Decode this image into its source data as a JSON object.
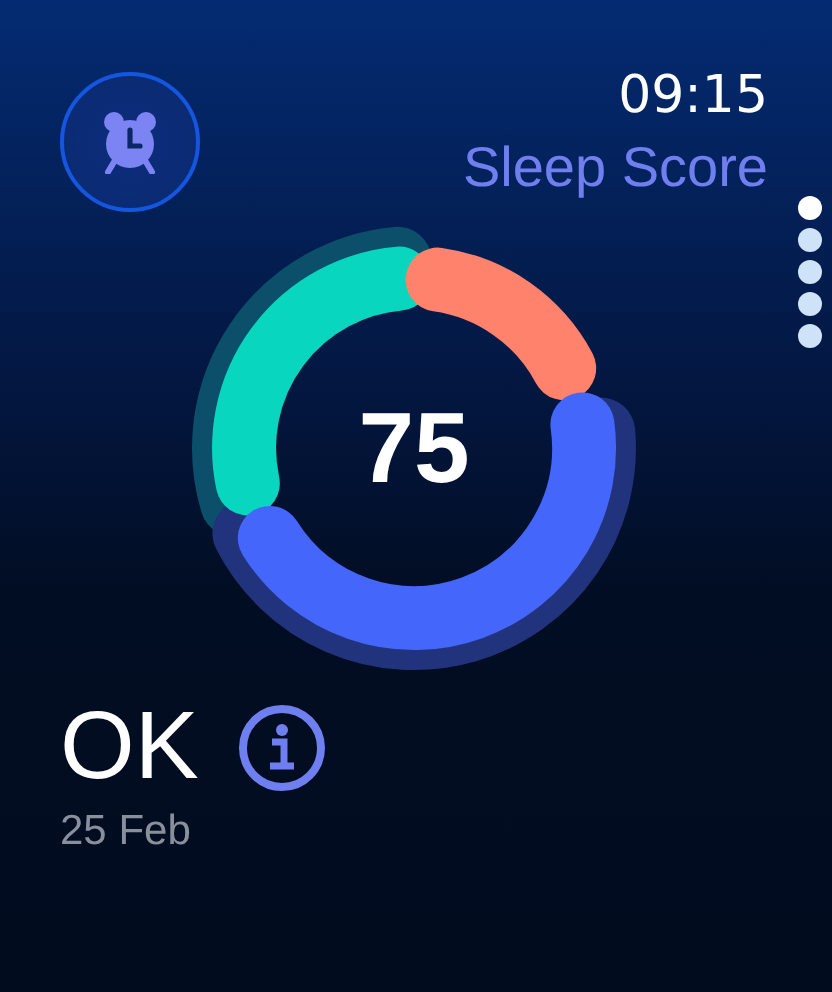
{
  "time": "09:15",
  "title": "Sleep Score",
  "page_dots": [
    {
      "selected": true
    },
    {
      "selected": false
    },
    {
      "selected": false
    },
    {
      "selected": false
    },
    {
      "selected": false
    }
  ],
  "score": "75",
  "rating": "OK",
  "date": "25 Feb"
}
